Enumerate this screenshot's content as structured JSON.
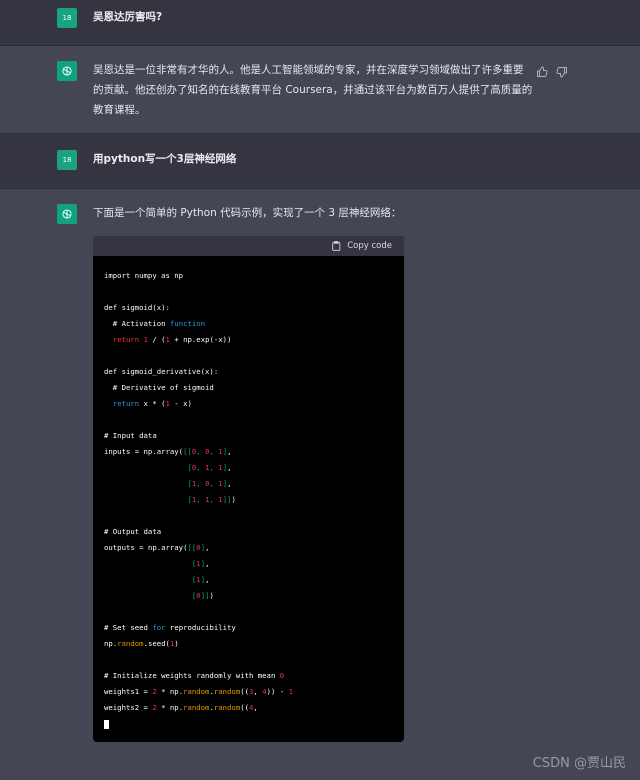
{
  "messages": {
    "q1": {
      "avatar": "18",
      "text": "吴恩达厉害吗?"
    },
    "a1": {
      "text": "吴恩达是一位非常有才华的人。他是人工智能领域的专家，并在深度学习领域做出了许多重要的贡献。他还创办了知名的在线教育平台 Coursera，并通过该平台为数百万人提供了高质量的教育课程。"
    },
    "q2": {
      "avatar": "18",
      "text": "用python写一个3层神经网络"
    },
    "a2": {
      "text": "下面是一个简单的 Python 代码示例，实现了一个 3 层神经网络："
    }
  },
  "code": {
    "copy_label": "Copy code",
    "lines": [
      "import numpy as np",
      "",
      "def sigmoid(x):",
      "  # Activation function",
      "  return 1 / (1 + np.exp(-x))",
      "",
      "def sigmoid_derivative(x):",
      "  # Derivative of sigmoid",
      "  return x * (1 - x)",
      "",
      "# Input data",
      "inputs = np.array([[0, 0, 1],",
      "                   [0, 1, 1],",
      "                   [1, 0, 1],",
      "                   [1, 1, 1]])",
      "",
      "# Output data",
      "outputs = np.array([[0],",
      "                    [1],",
      "                    [1],",
      "                    [0]])",
      "",
      "# Set seed for reproducibility",
      "np.random.seed(1)",
      "",
      "# Initialize weights randomly with mean 0",
      "weights1 = 2 * np.random.random((3, 4)) - 1",
      "weights2 = 2 * np.random.random((4,"
    ]
  },
  "watermark": "CSDN @贾山民",
  "icons": {
    "user_avatar": "user-avatar",
    "bot_avatar": "openai-logo-icon",
    "like": "thumbs-up-icon",
    "dislike": "thumbs-down-icon",
    "copy": "clipboard-icon"
  }
}
